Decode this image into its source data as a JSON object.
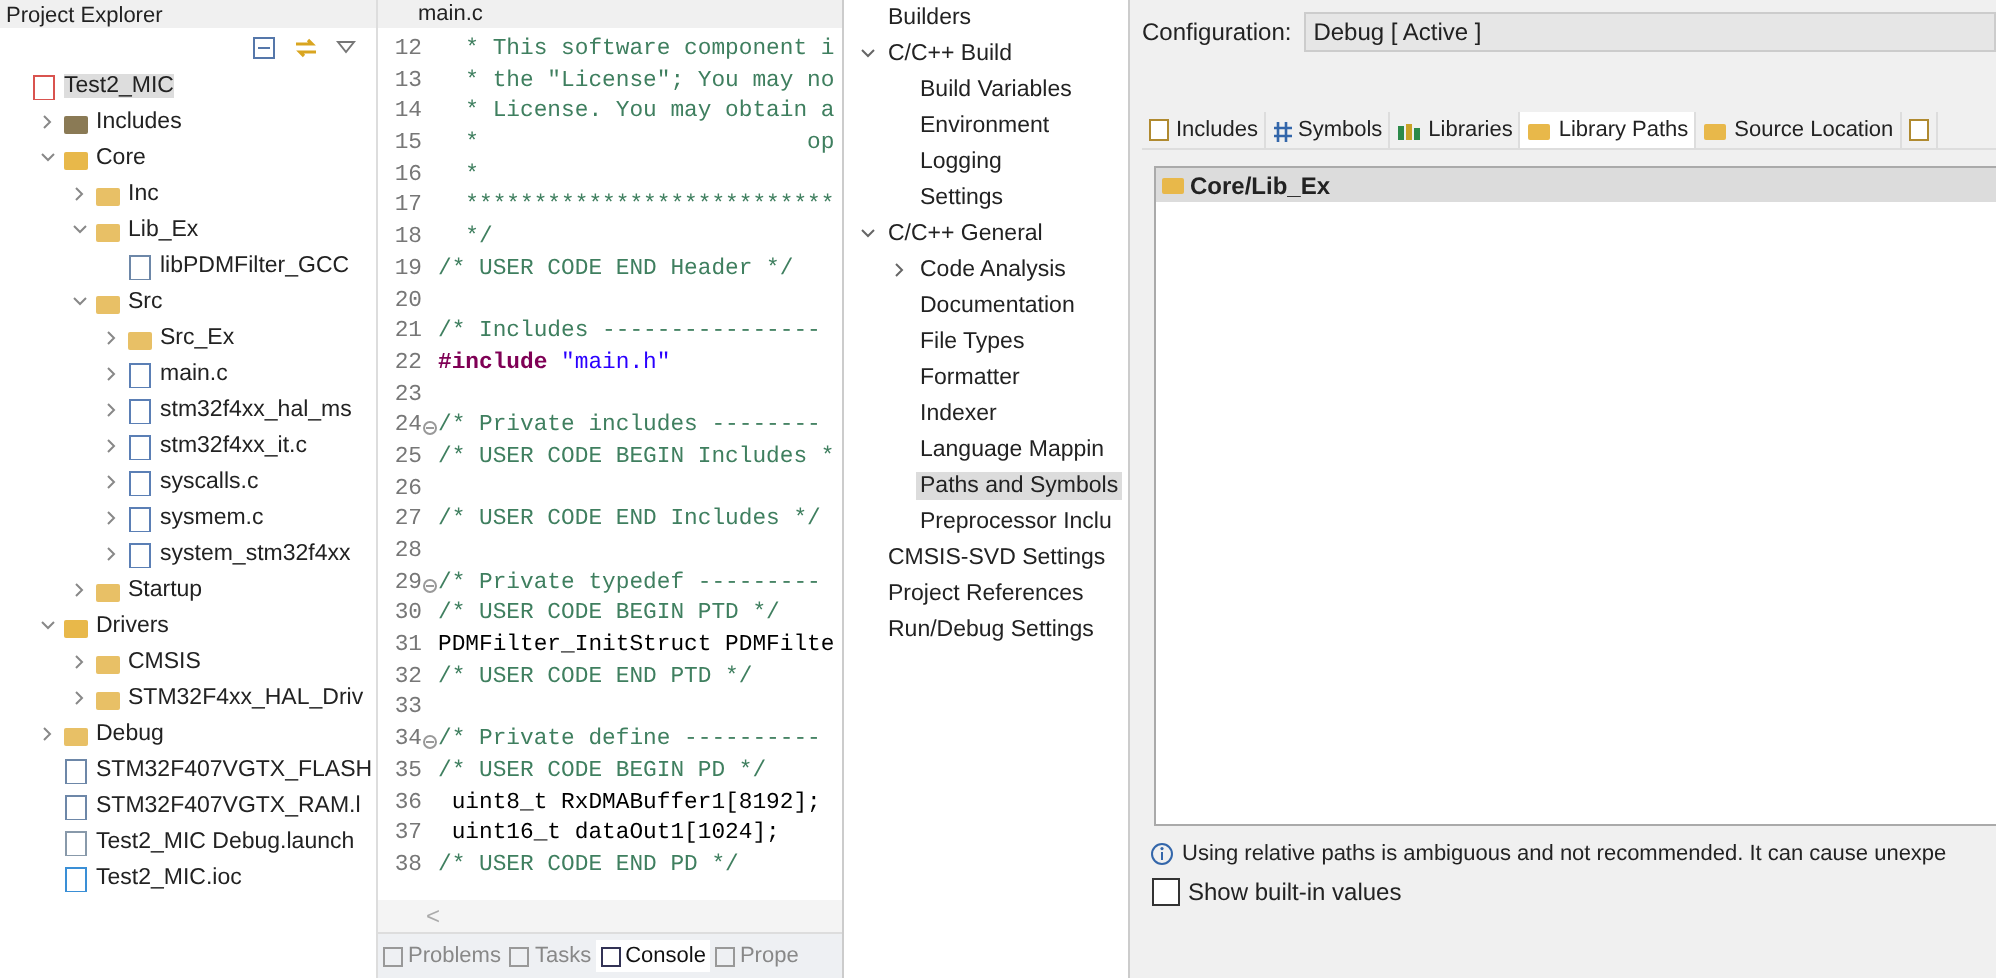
{
  "explorer": {
    "title": "Project Explorer",
    "tree": [
      {
        "label": "Test2_MIC",
        "kind": "project",
        "selected": true,
        "children": [
          {
            "label": "Includes",
            "kind": "includes",
            "expanded": false,
            "selected": false
          },
          {
            "label": "Core",
            "kind": "source-folder",
            "expanded": true,
            "selected": false,
            "children": [
              {
                "label": "Inc",
                "kind": "folder",
                "expanded": false,
                "selected": false
              },
              {
                "label": "Lib_Ex",
                "kind": "folder",
                "expanded": true,
                "selected": false,
                "children": [
                  {
                    "label": "libPDMFilter_GCC",
                    "kind": "library",
                    "selected": false
                  }
                ]
              },
              {
                "label": "Src",
                "kind": "folder",
                "expanded": true,
                "selected": false,
                "children": [
                  {
                    "label": "Src_Ex",
                    "kind": "folder",
                    "expanded": false,
                    "selected": false
                  },
                  {
                    "label": "main.c",
                    "kind": "c-file",
                    "expanded": false,
                    "selected": false
                  },
                  {
                    "label": "stm32f4xx_hal_ms",
                    "kind": "c-file",
                    "expanded": false,
                    "selected": false
                  },
                  {
                    "label": "stm32f4xx_it.c",
                    "kind": "c-file",
                    "expanded": false,
                    "selected": false
                  },
                  {
                    "label": "syscalls.c",
                    "kind": "c-file",
                    "expanded": false,
                    "selected": false
                  },
                  {
                    "label": "sysmem.c",
                    "kind": "c-file",
                    "expanded": false,
                    "selected": false
                  },
                  {
                    "label": "system_stm32f4xx",
                    "kind": "c-file",
                    "expanded": false,
                    "selected": false
                  }
                ]
              },
              {
                "label": "Startup",
                "kind": "folder",
                "expanded": false,
                "selected": false
              }
            ]
          },
          {
            "label": "Drivers",
            "kind": "source-folder",
            "expanded": true,
            "selected": false,
            "children": [
              {
                "label": "CMSIS",
                "kind": "folder",
                "expanded": false,
                "selected": false
              },
              {
                "label": "STM32F4xx_HAL_Driv",
                "kind": "folder",
                "expanded": false,
                "selected": false
              }
            ]
          },
          {
            "label": "Debug",
            "kind": "folder",
            "expanded": false,
            "selected": false
          },
          {
            "label": "STM32F407VGTX_FLASH",
            "kind": "linker",
            "selected": false
          },
          {
            "label": "STM32F407VGTX_RAM.l",
            "kind": "linker",
            "selected": false
          },
          {
            "label": "Test2_MIC Debug.launch",
            "kind": "launch",
            "selected": false
          },
          {
            "label": "Test2_MIC.ioc",
            "kind": "mx",
            "selected": false
          }
        ]
      }
    ]
  },
  "editor": {
    "tab": "main.c",
    "lines": [
      {
        "num": "12",
        "fold": false,
        "segments": [
          {
            "kind": "comment",
            "text": "  * This software component i"
          }
        ]
      },
      {
        "num": "13",
        "fold": false,
        "segments": [
          {
            "kind": "comment",
            "text": "  * the \"License\"; You may no"
          }
        ]
      },
      {
        "num": "14",
        "fold": false,
        "segments": [
          {
            "kind": "comment",
            "text": "  * License. You may obtain a"
          }
        ]
      },
      {
        "num": "15",
        "fold": false,
        "segments": [
          {
            "kind": "comment",
            "text": "  *                        op"
          }
        ]
      },
      {
        "num": "16",
        "fold": false,
        "segments": [
          {
            "kind": "comment",
            "text": "  *"
          }
        ]
      },
      {
        "num": "17",
        "fold": false,
        "segments": [
          {
            "kind": "comment",
            "text": "  ***************************"
          }
        ]
      },
      {
        "num": "18",
        "fold": false,
        "segments": [
          {
            "kind": "comment",
            "text": "  */"
          }
        ]
      },
      {
        "num": "19",
        "fold": false,
        "segments": [
          {
            "kind": "comment",
            "text": "/* USER CODE END Header */"
          }
        ]
      },
      {
        "num": "20",
        "fold": false
      },
      {
        "num": "21",
        "fold": false,
        "segments": [
          {
            "kind": "comment",
            "text": "/* Includes ----------------"
          }
        ]
      },
      {
        "num": "22",
        "fold": false,
        "segments": [
          {
            "kind": "keyword",
            "text": "#include"
          },
          {
            "kind": "string",
            "text": " \"main.h\""
          }
        ]
      },
      {
        "num": "23",
        "fold": false
      },
      {
        "num": "24",
        "fold": true,
        "segments": [
          {
            "kind": "comment",
            "text": "/* Private includes --------"
          }
        ]
      },
      {
        "num": "25",
        "fold": false,
        "segments": [
          {
            "kind": "comment",
            "text": "/* USER CODE BEGIN Includes *"
          }
        ]
      },
      {
        "num": "26",
        "fold": false
      },
      {
        "num": "27",
        "fold": false,
        "segments": [
          {
            "kind": "comment",
            "text": "/* USER CODE END Includes */"
          }
        ]
      },
      {
        "num": "28",
        "fold": false
      },
      {
        "num": "29",
        "fold": true,
        "segments": [
          {
            "kind": "comment",
            "text": "/* Private typedef ---------"
          }
        ]
      },
      {
        "num": "30",
        "fold": false,
        "segments": [
          {
            "kind": "comment",
            "text": "/* USER CODE BEGIN PTD */"
          }
        ]
      },
      {
        "num": "31",
        "fold": false,
        "segments": [
          {
            "kind": "code",
            "text": "PDMFilter_InitStruct PDMFilte"
          }
        ]
      },
      {
        "num": "32",
        "fold": false,
        "segments": [
          {
            "kind": "comment",
            "text": "/* USER CODE END PTD */"
          }
        ]
      },
      {
        "num": "33",
        "fold": false
      },
      {
        "num": "34",
        "fold": true,
        "segments": [
          {
            "kind": "comment",
            "text": "/* Private define ----------"
          }
        ]
      },
      {
        "num": "35",
        "fold": false,
        "segments": [
          {
            "kind": "comment",
            "text": "/* USER CODE BEGIN PD */"
          }
        ]
      },
      {
        "num": "36",
        "fold": false,
        "segments": [
          {
            "kind": "code",
            "text": " uint8_t RxDMABuffer1[8192];"
          }
        ]
      },
      {
        "num": "37",
        "fold": false,
        "segments": [
          {
            "kind": "code",
            "text": " uint16_t dataOut1[1024];"
          }
        ]
      },
      {
        "num": "38",
        "fold": false,
        "segments": [
          {
            "kind": "comment",
            "text": "/* USER CODE END PD */"
          }
        ]
      }
    ],
    "scroll_arrow": "<"
  },
  "bottom_tabs": [
    {
      "label": "Problems",
      "selected": false
    },
    {
      "label": "Tasks",
      "selected": false
    },
    {
      "label": "Console",
      "selected": true
    },
    {
      "label": "Prope",
      "selected": false
    }
  ],
  "properties_nav": [
    {
      "label": "Builders",
      "selected": false
    },
    {
      "label": "C/C++ Build",
      "expanded": true,
      "selected": false,
      "children": [
        {
          "label": "Build Variables",
          "selected": false
        },
        {
          "label": "Environment",
          "selected": false
        },
        {
          "label": "Logging",
          "selected": false
        },
        {
          "label": "Settings",
          "selected": false
        }
      ]
    },
    {
      "label": "C/C++ General",
      "expanded": true,
      "selected": false,
      "children": [
        {
          "label": "Code Analysis",
          "expanded": false,
          "selected": false
        },
        {
          "label": "Documentation",
          "selected": false
        },
        {
          "label": "File Types",
          "selected": false
        },
        {
          "label": "Formatter",
          "selected": false
        },
        {
          "label": "Indexer",
          "selected": false
        },
        {
          "label": "Language Mappin",
          "selected": false
        },
        {
          "label": "Paths and Symbols",
          "selected": true
        },
        {
          "label": "Preprocessor Inclu",
          "selected": false
        }
      ]
    },
    {
      "label": "CMSIS-SVD Settings",
      "selected": false
    },
    {
      "label": "Project References",
      "selected": false
    },
    {
      "label": "Run/Debug Settings",
      "selected": false
    }
  ],
  "configuration": {
    "label": "Configuration:",
    "value": "Debug  [ Active ]"
  },
  "tabs": [
    {
      "label": "Includes",
      "kind": "includes",
      "selected": false
    },
    {
      "label": "Symbols",
      "kind": "symbols",
      "selected": false
    },
    {
      "label": "Libraries",
      "kind": "libraries",
      "selected": false
    },
    {
      "label": "Library Paths",
      "kind": "library-paths",
      "selected": true
    },
    {
      "label": "Source Location",
      "kind": "source",
      "selected": false
    },
    {
      "kind": "more",
      "selected": false
    }
  ],
  "paths": [
    {
      "label": "Core/Lib_Ex",
      "selected": true
    }
  ],
  "info": "Using relative paths is ambiguous and not recommended. It can cause unexpe",
  "show_builtin": {
    "label": "Show built-in values",
    "checked": false
  }
}
